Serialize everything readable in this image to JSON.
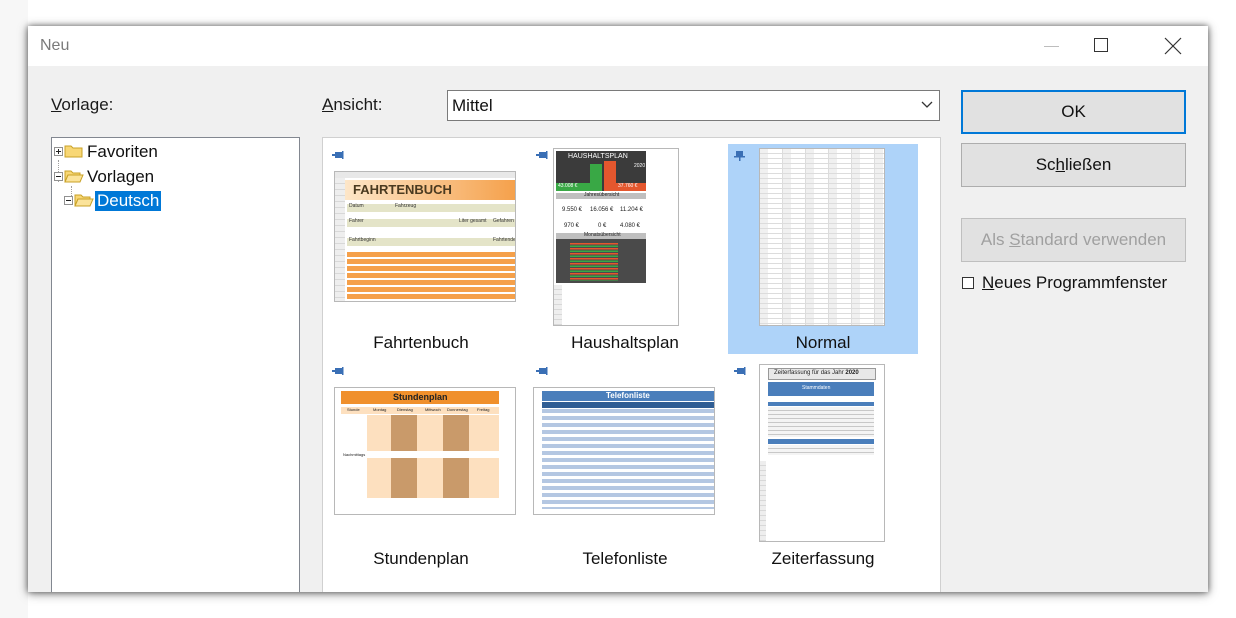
{
  "dialog": {
    "title": "Neu",
    "controls": {
      "minimize": "minimize-icon",
      "maximize": "maximize-icon",
      "close": "close-icon"
    }
  },
  "left": {
    "vorlage_label_prefix": "V",
    "vorlage_label_rest": "orlage:"
  },
  "tree": {
    "items": [
      {
        "label": "Favoriten",
        "icon": "folder-closed-icon",
        "expanded": false
      },
      {
        "label": "Vorlagen",
        "icon": "folder-open-icon",
        "expanded": true
      },
      {
        "label": "Deutsch",
        "icon": "folder-open-icon",
        "expanded": true,
        "selected": true
      }
    ]
  },
  "view": {
    "label_prefix": "A",
    "label_rest": "nsicht:",
    "selected": "Mittel"
  },
  "templates": [
    {
      "name": "Fahrtenbuch",
      "thumb_title": "FAHRTENBUCH",
      "fields": [
        "Datum",
        "Fahrzeug",
        "Fahrer",
        "Liter gesamt",
        "Gefahren",
        "Fahrtbeginn",
        "Fahrtende"
      ]
    },
    {
      "name": "Haushaltsplan",
      "thumb_title": "HAUSHALTSPLAN",
      "year": "2020",
      "left_value": "43.008 €",
      "right_value": "37.760 €",
      "section1": "Jahresübersicht",
      "values": [
        "9.550 €",
        "16.056 €",
        "11.204 €",
        "970 €",
        "0 €",
        "4.080 €"
      ],
      "section2": "Monatsübersicht"
    },
    {
      "name": "Normal",
      "selected": true
    },
    {
      "name": "Stundenplan",
      "thumb_title": "Stundenplan",
      "days": [
        "Stunde",
        "Montag",
        "Dienstag",
        "Mittwoch",
        "Donnerstag",
        "Freitag"
      ],
      "section": "Nachmittags"
    },
    {
      "name": "Telefonliste",
      "thumb_title": "Telefonliste"
    },
    {
      "name": "Zeiterfassung",
      "thumb_title": "Zeiterfassung für das Jahr",
      "year": "2020",
      "section": "Stammdaten"
    }
  ],
  "buttons": {
    "ok": "OK",
    "close_pre": "Sc",
    "close_u": "h",
    "close_post": "ließen",
    "default_pre": "Als ",
    "default_u": "S",
    "default_post": "tandard verwenden"
  },
  "new_window": {
    "u": "N",
    "rest": "eues Programmfenster",
    "checked": false
  },
  "colors": {
    "selection": "#0078d7",
    "tile_selected": "#aed3f9",
    "orange": "#f5a04a",
    "dark": "#3b3b3b",
    "blue_header": "#4a7ebb"
  }
}
